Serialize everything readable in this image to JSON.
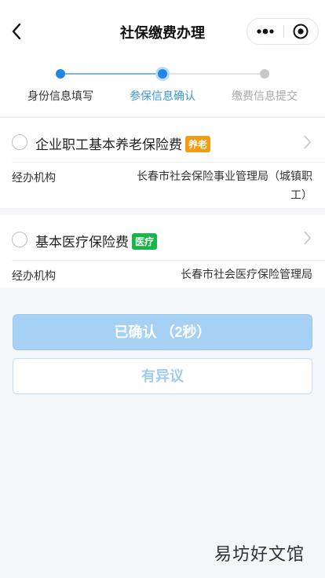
{
  "header": {
    "title": "社保缴费办理",
    "back_icon": "chevron-left-icon",
    "more_icon": "more-dots-icon",
    "close_icon": "target-close-icon"
  },
  "steps": [
    {
      "label": "身份信息填写",
      "state": "done"
    },
    {
      "label": "参保信息确认",
      "state": "active"
    },
    {
      "label": "缴费信息提交",
      "state": "pending"
    }
  ],
  "colors": {
    "accent": "#1f87e8",
    "active_text": "#3a9ad9",
    "pending": "#c8c8c8",
    "tag_orange": "#f39c12",
    "tag_green": "#18b548",
    "confirm_bg": "#a6d1f5"
  },
  "items": [
    {
      "name": "企业职工基本养老保险费",
      "tag": "养老",
      "key": "经办机构",
      "value_line1": "长春市社会保险事业管理局（城镇职",
      "value_line2": "工）"
    },
    {
      "name": "基本医疗保险费",
      "tag": "医疗",
      "key": "经办机构",
      "value_line1": "长春市社会医疗保险管理局"
    }
  ],
  "buttons": {
    "confirm": "已确认 （2秒）",
    "dispute": "有异议"
  },
  "watermark": "易坊好文馆"
}
